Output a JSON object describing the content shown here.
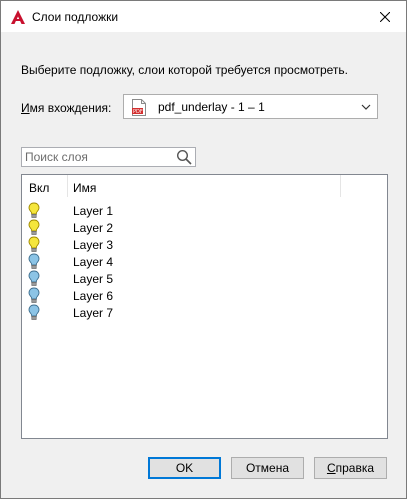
{
  "window": {
    "title": "Слои подложки",
    "app_icon": "autocad-a-icon",
    "close_glyph": "✕"
  },
  "instruction": "Выберите подложку, слои которой требуется просмотреть.",
  "reference": {
    "label_underlined": "И",
    "label_rest": "мя вхождения:",
    "value": "pdf_underlay - 1 – 1",
    "icon": "pdf-file-icon"
  },
  "search": {
    "placeholder": "Поиск слоя",
    "value": ""
  },
  "layer_list": {
    "columns": [
      "Вкл",
      "Имя"
    ],
    "rows": [
      {
        "name": "Layer 1",
        "on": true
      },
      {
        "name": "Layer 2",
        "on": true
      },
      {
        "name": "Layer 3",
        "on": true
      },
      {
        "name": "Layer 4",
        "on": false
      },
      {
        "name": "Layer 5",
        "on": false
      },
      {
        "name": "Layer 6",
        "on": false
      },
      {
        "name": "Layer 7",
        "on": false
      }
    ]
  },
  "buttons": {
    "ok": "OK",
    "cancel": "Отмена",
    "help_underlined": "С",
    "help_rest": "правка"
  },
  "colors": {
    "accent": "#0078d7",
    "bulb_on": "#f5e63c",
    "bulb_off": "#8cc4e6",
    "autocad_red": "#c8102e"
  }
}
